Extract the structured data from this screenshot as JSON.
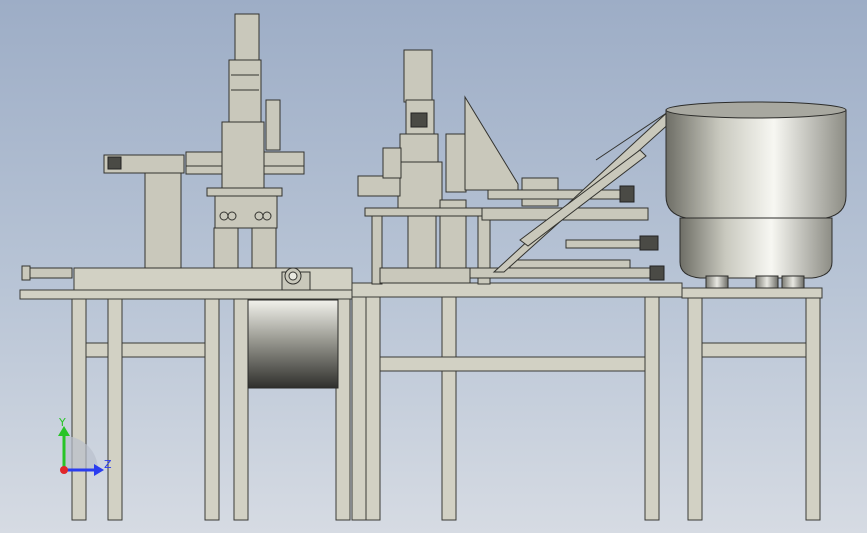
{
  "viewport": {
    "background_top": "#9dadc6",
    "background_bottom": "#d6dbe3"
  },
  "model": {
    "frame_color": "#d2d1c4",
    "edge_color": "#33332f"
  },
  "triad": {
    "y_label": "Y",
    "z_label": "Z",
    "y_color": "#27c427",
    "z_color": "#2a3df0",
    "x_color": "#e0262a"
  }
}
